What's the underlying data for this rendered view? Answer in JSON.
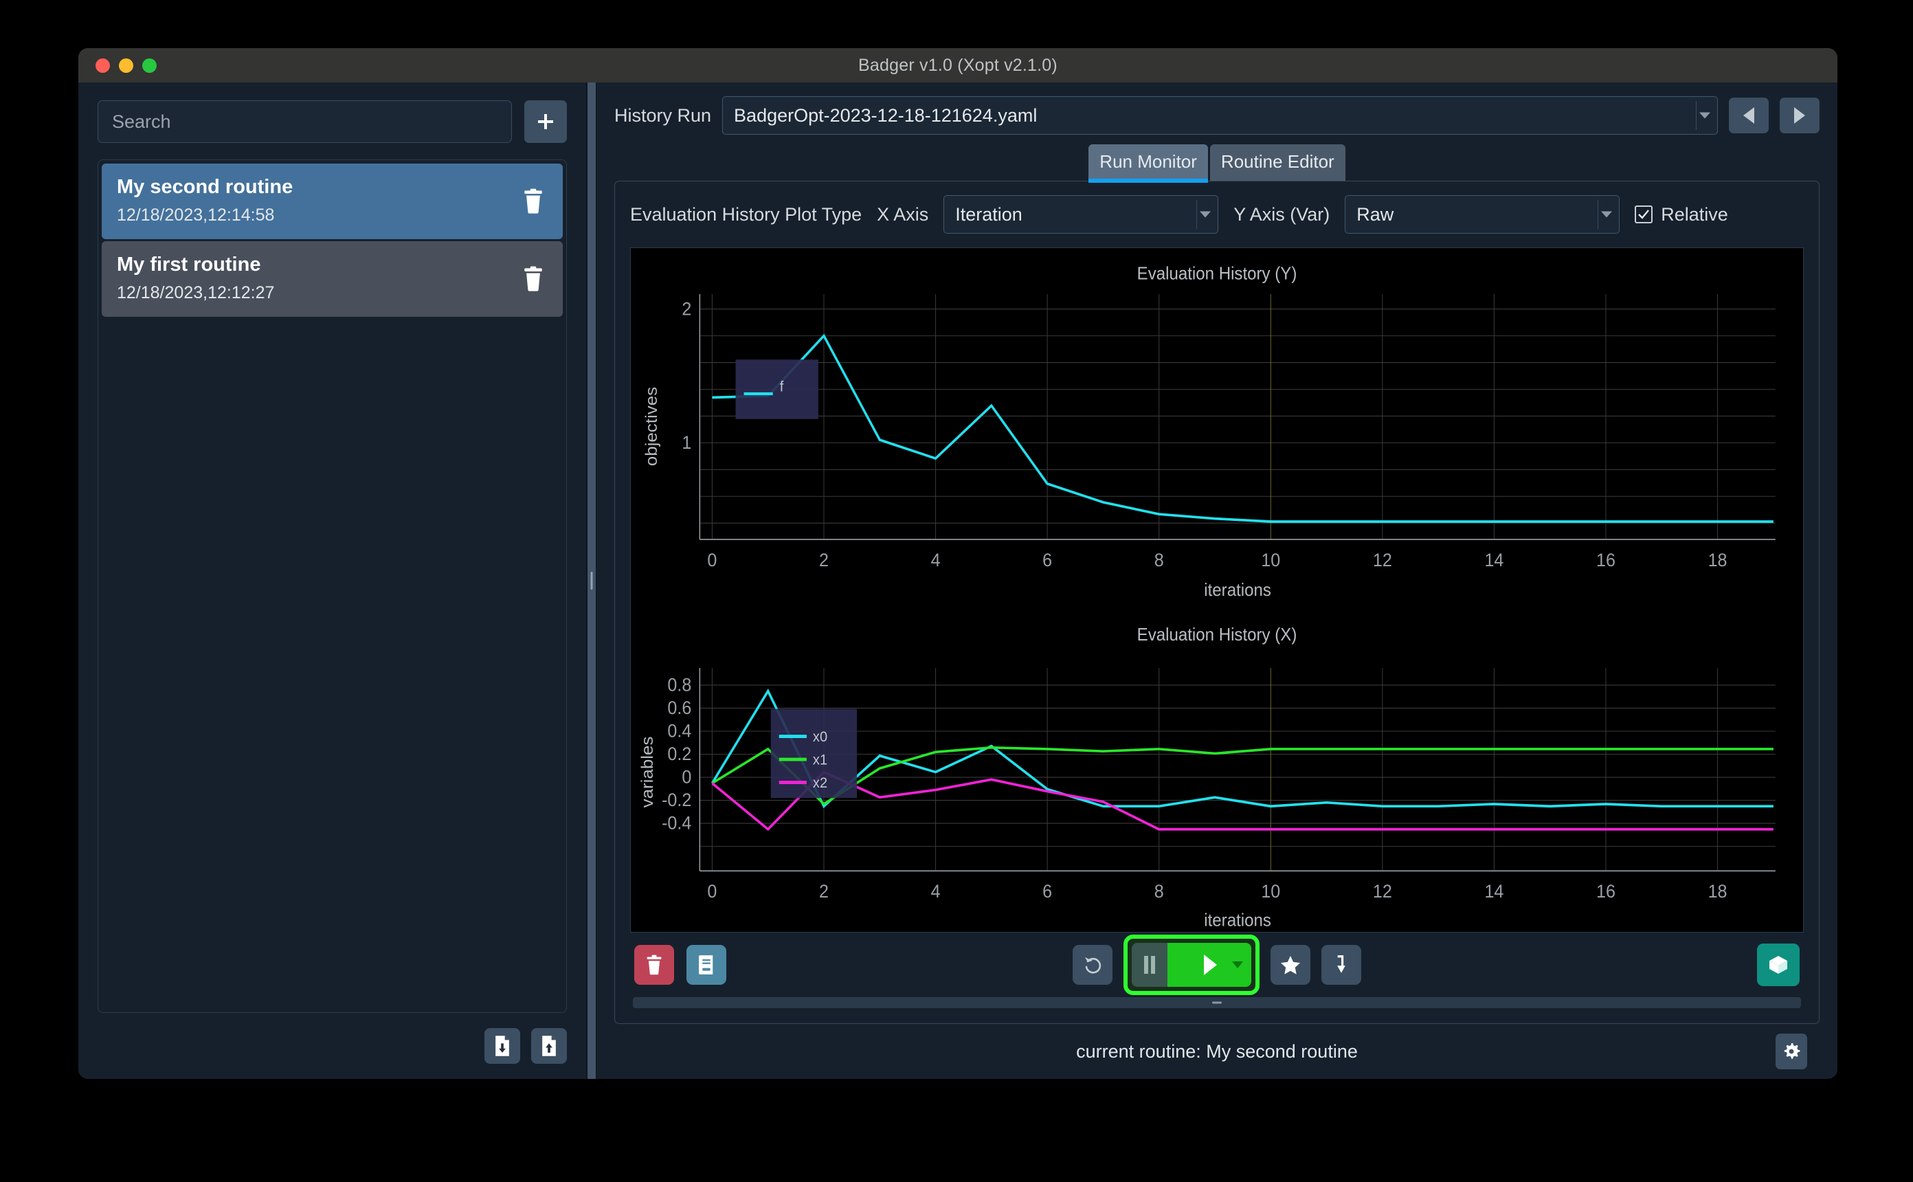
{
  "window": {
    "title": "Badger v1.0 (Xopt v2.1.0)",
    "traffic_lights": [
      "close-red",
      "minimize-yellow",
      "maximize-green"
    ]
  },
  "sidebar": {
    "search": {
      "placeholder": "Search",
      "value": ""
    },
    "add_button_icon": "plus-icon",
    "routines": [
      {
        "name": "My second routine",
        "timestamp": "12/18/2023,12:14:58",
        "selected": true
      },
      {
        "name": "My first routine",
        "timestamp": "12/18/2023,12:12:27",
        "selected": false
      }
    ],
    "footer_buttons": [
      {
        "icon": "file-import-icon",
        "name": "import-routine-button"
      },
      {
        "icon": "file-export-icon",
        "name": "export-routine-button"
      }
    ]
  },
  "main": {
    "history": {
      "label": "History Run",
      "value": "BadgerOpt-2023-12-18-121624.yaml",
      "prev_icon": "triangle-left-icon",
      "next_icon": "triangle-right-icon"
    },
    "tabs": [
      {
        "label": "Run Monitor",
        "active": true
      },
      {
        "label": "Routine Editor",
        "active": false
      }
    ],
    "controls": {
      "plot_type_label": "Evaluation History Plot Type",
      "x_axis_label": "X Axis",
      "x_axis_value": "Iteration",
      "y_axis_label": "Y Axis (Var)",
      "y_axis_value": "Raw",
      "relative_label": "Relative",
      "relative_checked": true
    },
    "toolbar": {
      "delete_icon": "trash-icon",
      "logbook_icon": "book-icon",
      "reset_icon": "undo-icon",
      "pause_icon": "pause-icon",
      "run_icon": "play-icon",
      "star_icon": "star-icon",
      "jump_icon": "jump-to-optimum-icon",
      "extension_icon": "cube-icon"
    },
    "status": {
      "text": "current routine: My second routine",
      "settings_icon": "gear-icon"
    }
  },
  "chart_data": [
    {
      "type": "line",
      "title": "Evaluation History (Y)",
      "xlabel": "iterations",
      "ylabel": "objectives",
      "xlim": [
        -0.8,
        19.8
      ],
      "ylim": [
        0.42,
        2.12
      ],
      "xticks": [
        0,
        2,
        4,
        6,
        8,
        10,
        12,
        14,
        16,
        18
      ],
      "yticks": [
        1,
        2
      ],
      "grid": true,
      "legend": {
        "position": "top-left",
        "entries": [
          "f"
        ]
      },
      "x": [
        0,
        1,
        2,
        3,
        4,
        5,
        6,
        7,
        8,
        9,
        10,
        11,
        12,
        13,
        14,
        15,
        16,
        17,
        18,
        19
      ],
      "series": [
        {
          "name": "f",
          "color": "#22e0ee",
          "values": [
            1.51,
            1.52,
            1.94,
            1.22,
            1.09,
            1.36,
            0.86,
            0.73,
            0.65,
            0.62,
            0.6,
            0.6,
            0.6,
            0.6,
            0.6,
            0.6,
            0.6,
            0.6,
            0.6,
            0.6
          ]
        }
      ]
    },
    {
      "type": "line",
      "title": "Evaluation History (X)",
      "xlabel": "iterations",
      "ylabel": "variables",
      "xlim": [
        -0.8,
        19.8
      ],
      "ylim": [
        -0.52,
        0.88
      ],
      "xticks": [
        0,
        2,
        4,
        6,
        8,
        10,
        12,
        14,
        16,
        18
      ],
      "yticks": [
        -0.4,
        -0.2,
        0,
        0.2,
        0.4,
        0.6,
        0.8
      ],
      "ytick_labels": [
        "-0.4",
        "-0.2",
        "0",
        "0.2",
        "0.4",
        "0.6",
        "0.8"
      ],
      "grid": true,
      "legend": {
        "position": "top-left",
        "entries": [
          "x0",
          "x1",
          "x2"
        ]
      },
      "x": [
        0,
        1,
        2,
        3,
        4,
        5,
        6,
        7,
        8,
        9,
        10,
        11,
        12,
        13,
        14,
        15,
        16,
        17,
        18,
        19
      ],
      "series": [
        {
          "name": "x0",
          "color": "#22e0ee",
          "values": [
            0.0,
            0.8,
            -0.2,
            0.24,
            0.1,
            0.32,
            -0.05,
            -0.2,
            -0.2,
            -0.12,
            -0.2,
            -0.17,
            -0.2,
            -0.2,
            -0.18,
            -0.2,
            -0.18,
            -0.2,
            -0.2,
            -0.2
          ]
        },
        {
          "name": "x1",
          "color": "#2ae62a",
          "values": [
            0.0,
            0.3,
            -0.18,
            0.13,
            0.27,
            0.31,
            0.3,
            0.28,
            0.3,
            0.26,
            0.3,
            0.3,
            0.3,
            0.3,
            0.3,
            0.3,
            0.3,
            0.3,
            0.3,
            0.3
          ]
        },
        {
          "name": "x2",
          "color": "#f222d6",
          "values": [
            0.0,
            -0.4,
            0.1,
            -0.12,
            -0.06,
            0.03,
            -0.07,
            -0.16,
            -0.4,
            -0.4,
            -0.4,
            -0.4,
            -0.4,
            -0.4,
            -0.4,
            -0.4,
            -0.4,
            -0.4,
            -0.4,
            -0.4
          ]
        }
      ]
    }
  ]
}
